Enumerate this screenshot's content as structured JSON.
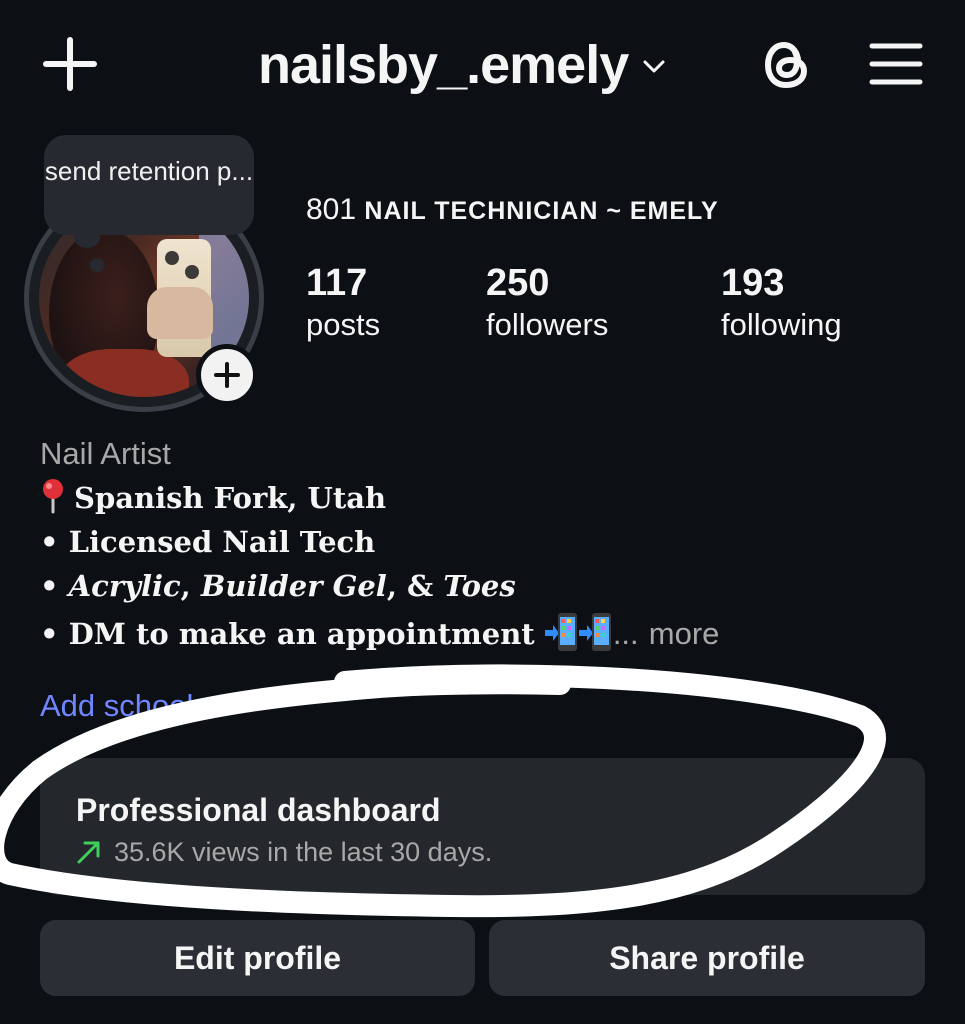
{
  "header": {
    "username": "nailsby_.emely",
    "icons": [
      "plus-icon",
      "chevron-down-icon",
      "threads-icon",
      "hamburger-menu-icon"
    ]
  },
  "avatar": {
    "note_text": "send retention p..."
  },
  "profile": {
    "name_prefix": "801",
    "name_rest": "NAIL TECHNICIAN ~ EMELY",
    "stats": [
      {
        "value": "117",
        "label": "posts"
      },
      {
        "value": "250",
        "label": "followers"
      },
      {
        "value": "193",
        "label": "following"
      }
    ]
  },
  "bio": {
    "category": "Nail Artist",
    "location": "Spanish Fork, Utah",
    "line2": "• Licensed Nail Tech",
    "line3_bullet": "•",
    "line3_acrylic": "Acrylic",
    "line3_sep1": ",",
    "line3_builder": "Builder Gel",
    "line3_sep2": ", &",
    "line3_toes": "Toes",
    "line4": "• DM to make an appointment",
    "line4_ellipsis": "...",
    "more_label": "more",
    "add_school_label": "Add school"
  },
  "dashboard": {
    "title": "Professional dashboard",
    "subtitle": "35.6K views in the last 30 days.",
    "trend_color": "#3ecf5a"
  },
  "actions": {
    "edit_label": "Edit profile",
    "share_label": "Share profile"
  },
  "colors": {
    "background": "#0c1014",
    "link": "#6f86ff",
    "button": "#2b2f35"
  }
}
